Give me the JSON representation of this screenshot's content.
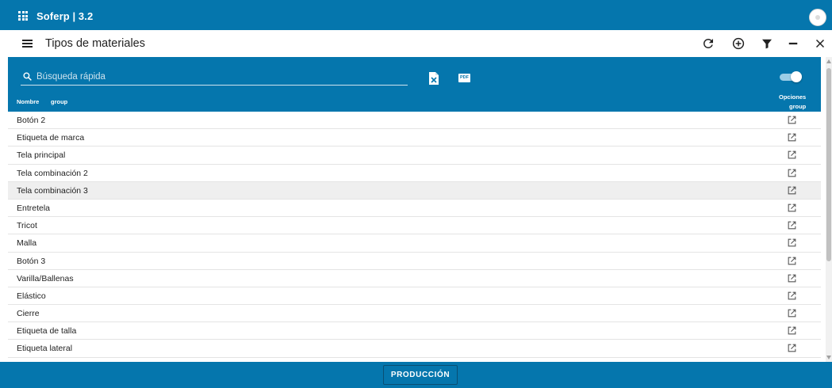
{
  "app": {
    "brand": "Soferp | 3.2",
    "accent_color": "#0576ad"
  },
  "titlebar": {
    "title": "Tipos de materiales",
    "icons": [
      "refresh-icon",
      "add-circle-icon",
      "filter-icon",
      "minimize-icon",
      "close-icon"
    ]
  },
  "search": {
    "placeholder": "Búsqueda rápida",
    "value": ""
  },
  "export": {
    "excel_icon": "excel-export-icon",
    "pdf_label": "PDF"
  },
  "toggle": {
    "on": true
  },
  "table": {
    "columns": {
      "name": "Nombre",
      "group": "group",
      "options_line1": "Opciones",
      "options_line2": "group"
    },
    "rows": [
      {
        "name": "Botón 2"
      },
      {
        "name": "Etiqueta de marca"
      },
      {
        "name": "Tela principal"
      },
      {
        "name": "Tela combinación 2"
      },
      {
        "name": "Tela combinación 3",
        "selected": true
      },
      {
        "name": "Entretela"
      },
      {
        "name": "Tricot"
      },
      {
        "name": "Malla"
      },
      {
        "name": "Botón 3"
      },
      {
        "name": "Varilla/Ballenas"
      },
      {
        "name": "Elástico"
      },
      {
        "name": "Cierre"
      },
      {
        "name": "Etiqueta de talla"
      },
      {
        "name": "Etiqueta lateral"
      },
      {
        "name": ""
      }
    ],
    "row_action_icon": "open-in-new-icon"
  },
  "bottom": {
    "button_label": "PRODUCCIÓN"
  }
}
